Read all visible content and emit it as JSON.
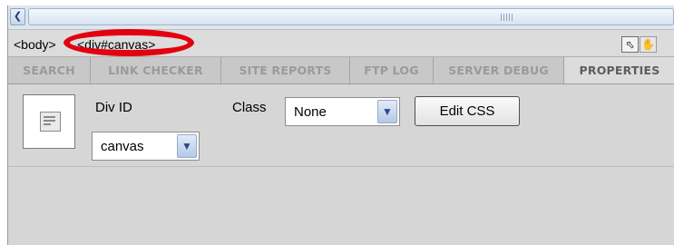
{
  "tag_selector": {
    "body_tag": "<body>",
    "div_tag": "<div#canvas>",
    "highlight_color": "#e3000f"
  },
  "tabs": [
    {
      "label": "SEARCH",
      "active": false
    },
    {
      "label": "LINK CHECKER",
      "active": false
    },
    {
      "label": "SITE REPORTS",
      "active": false
    },
    {
      "label": "FTP LOG",
      "active": false
    },
    {
      "label": "SERVER DEBUG",
      "active": false
    },
    {
      "label": "PROPERTIES",
      "active": true
    }
  ],
  "properties": {
    "div_id_label": "Div ID",
    "div_id_value": "canvas",
    "class_label": "Class",
    "class_value": "None",
    "edit_css_label": "Edit CSS"
  },
  "icons": {
    "scroll_left": "chevron-left-icon",
    "pointer_tool": "arrow-pointer-icon",
    "hand_tool": "hand-icon",
    "div_element": "div-element-icon"
  }
}
